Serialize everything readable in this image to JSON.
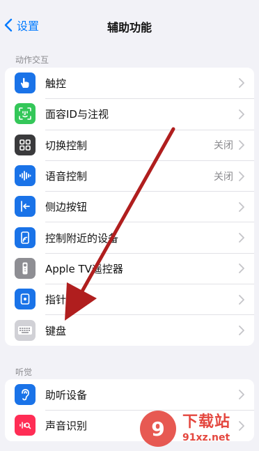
{
  "nav": {
    "back_label": "设置",
    "title": "辅助功能"
  },
  "sections": {
    "interaction": {
      "header": "动作交互",
      "items": [
        {
          "label": "触控",
          "value": "",
          "icon": "hand-touch-icon",
          "color": "#1a73e8"
        },
        {
          "label": "面容ID与注视",
          "value": "",
          "icon": "face-id-icon",
          "color": "#34c759"
        },
        {
          "label": "切换控制",
          "value": "关闭",
          "icon": "switch-grid-icon",
          "color": "#3a3a3c"
        },
        {
          "label": "语音控制",
          "value": "关闭",
          "icon": "voice-wave-icon",
          "color": "#1a73e8"
        },
        {
          "label": "侧边按钮",
          "value": "",
          "icon": "side-button-icon",
          "color": "#1a73e8"
        },
        {
          "label": "控制附近的设备",
          "value": "",
          "icon": "nearby-device-icon",
          "color": "#1a73e8"
        },
        {
          "label": "Apple TV遥控器",
          "value": "",
          "icon": "tv-remote-icon",
          "color": "#8e8e93"
        },
        {
          "label": "指针控制",
          "value": "",
          "icon": "pointer-icon",
          "color": "#1a73e8"
        },
        {
          "label": "键盘",
          "value": "",
          "icon": "keyboard-icon",
          "color": "#c7c7cc"
        }
      ]
    },
    "hearing": {
      "header": "听觉",
      "items": [
        {
          "label": "助听设备",
          "value": "",
          "icon": "ear-icon",
          "color": "#1a73e8"
        },
        {
          "label": "声音识别",
          "value": "",
          "icon": "sound-recognition-icon",
          "color": "#ff2d55"
        }
      ]
    }
  },
  "watermark": {
    "title": "下载站",
    "url": "91xz.net"
  }
}
